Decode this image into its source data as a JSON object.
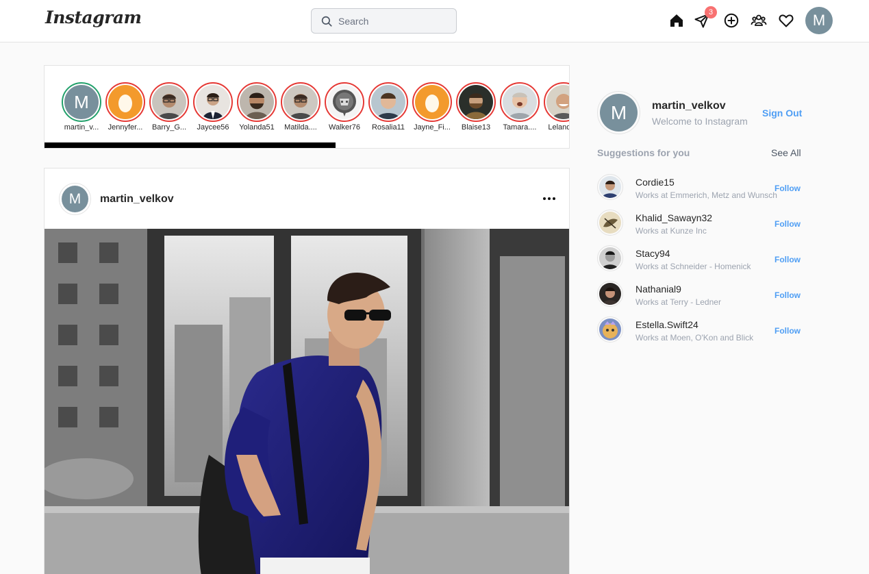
{
  "header": {
    "logo": "Instagram",
    "search_placeholder": "Search",
    "messages_badge": "3",
    "avatar_letter": "M",
    "icons": [
      "home-icon",
      "direct-message-icon",
      "add-post-icon",
      "people-icon",
      "heart-icon"
    ]
  },
  "stories": [
    {
      "label": "martin_v...",
      "type": "letter",
      "letter": "M",
      "seen": true
    },
    {
      "label": "Jennyfer...",
      "type": "egg"
    },
    {
      "label": "Barry_G...",
      "type": "photo"
    },
    {
      "label": "Jaycee56",
      "type": "photo"
    },
    {
      "label": "Yolanda51",
      "type": "photo"
    },
    {
      "label": "Matilda....",
      "type": "photo"
    },
    {
      "label": "Walker76",
      "type": "photo"
    },
    {
      "label": "Rosalia11",
      "type": "photo"
    },
    {
      "label": "Jayne_Fi...",
      "type": "egg"
    },
    {
      "label": "Blaise13",
      "type": "photo"
    },
    {
      "label": "Tamara....",
      "type": "photo"
    },
    {
      "label": "Leland....",
      "type": "photo"
    }
  ],
  "post": {
    "avatar_letter": "M",
    "username": "martin_velkov"
  },
  "profile": {
    "avatar_letter": "M",
    "username": "martin_velkov",
    "subtitle": "Welcome to Instagram",
    "signout_label": "Sign Out"
  },
  "suggestions": {
    "title": "Suggestions for you",
    "see_all": "See All",
    "follow_label": "Follow",
    "items": [
      {
        "name": "Cordie15",
        "sub": "Works at Emmerich, Metz and Wunsch"
      },
      {
        "name": "Khalid_Sawayn32",
        "sub": "Works at Kunze Inc"
      },
      {
        "name": "Stacy94",
        "sub": "Works at Schneider - Homenick"
      },
      {
        "name": "Nathanial9",
        "sub": "Works at Terry - Ledner"
      },
      {
        "name": "Estella.Swift24",
        "sub": "Works at Moen, O'Kon and Blick"
      }
    ]
  },
  "colors": {
    "accent": "#4f9ef4",
    "avatar_bg": "#78909c",
    "story_ring": "#e53935",
    "story_ring_seen": "#22a06b",
    "badge": "#f87171"
  }
}
